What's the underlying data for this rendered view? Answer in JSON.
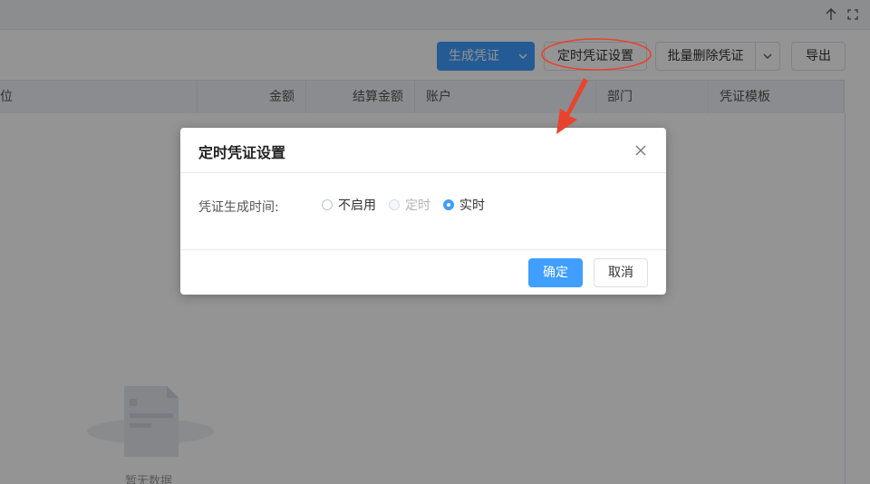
{
  "topbar": {
    "icons": [
      "arrow-up-icon",
      "fullscreen-icon"
    ]
  },
  "toolbar": {
    "generate_label": "生成凭证",
    "scheduled_label": "定时凭证设置",
    "batch_delete_label": "批量删除凭证",
    "export_label": "导出"
  },
  "table": {
    "columns": [
      "位",
      "金额",
      "结算金额",
      "账户",
      "部门",
      "凭证模板"
    ],
    "empty_text": "暂无数据"
  },
  "dialog": {
    "title": "定时凭证设置",
    "field_label": "凭证生成时间:",
    "options": [
      {
        "label": "不启用",
        "state": "unchecked"
      },
      {
        "label": "定时",
        "state": "disabled"
      },
      {
        "label": "实时",
        "state": "checked"
      }
    ],
    "ok_label": "确定",
    "cancel_label": "取消"
  },
  "colors": {
    "primary": "#409eff",
    "annotation": "#e8432e",
    "overlay": "rgba(0,0,0,0.42)"
  }
}
